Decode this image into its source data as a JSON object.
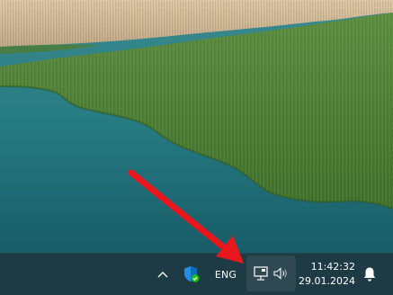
{
  "taskbar": {
    "language": "ENG",
    "time": "11:42:32",
    "date": "29.01.2024"
  },
  "icons": {
    "tray_overflow": "chevron-up-icon",
    "security": "windows-security-shield-icon",
    "network": "network-ethernet-icon",
    "volume": "speaker-volume-icon",
    "notifications": "bell-icon"
  },
  "colors": {
    "taskbar_bg": "#1e3a45",
    "annotation_arrow": "#e8171d",
    "shield_blue": "#1e90e6",
    "shield_check_green": "#16c60c"
  }
}
